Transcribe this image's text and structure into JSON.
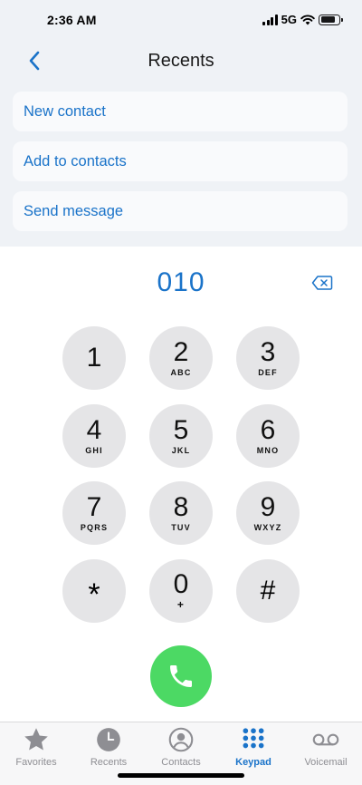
{
  "status_bar": {
    "time": "2:36 AM",
    "network": "5G",
    "battery_level": 0.85
  },
  "header": {
    "title": "Recents"
  },
  "actions": [
    {
      "label": "New contact"
    },
    {
      "label": "Add to contacts"
    },
    {
      "label": "Send message"
    }
  ],
  "dialer": {
    "number": "010",
    "keys": [
      {
        "digit": "1",
        "letters": ""
      },
      {
        "digit": "2",
        "letters": "ABC"
      },
      {
        "digit": "3",
        "letters": "DEF"
      },
      {
        "digit": "4",
        "letters": "GHI"
      },
      {
        "digit": "5",
        "letters": "JKL"
      },
      {
        "digit": "6",
        "letters": "MNO"
      },
      {
        "digit": "7",
        "letters": "PQRS"
      },
      {
        "digit": "8",
        "letters": "TUV"
      },
      {
        "digit": "9",
        "letters": "WXYZ"
      },
      {
        "digit": "*",
        "letters": ""
      },
      {
        "digit": "0",
        "letters": "+"
      },
      {
        "digit": "#",
        "letters": ""
      }
    ]
  },
  "tabs": [
    {
      "label": "Favorites",
      "icon": "star-icon"
    },
    {
      "label": "Recents",
      "icon": "clock-icon"
    },
    {
      "label": "Contacts",
      "icon": "person-circle-icon"
    },
    {
      "label": "Keypad",
      "icon": "keypad-icon",
      "active": true
    },
    {
      "label": "Voicemail",
      "icon": "voicemail-icon"
    }
  ],
  "colors": {
    "accent": "#1a73c9",
    "call": "#4cd964",
    "key_bg": "#e5e5e7",
    "top_bg": "#eff2f6"
  }
}
